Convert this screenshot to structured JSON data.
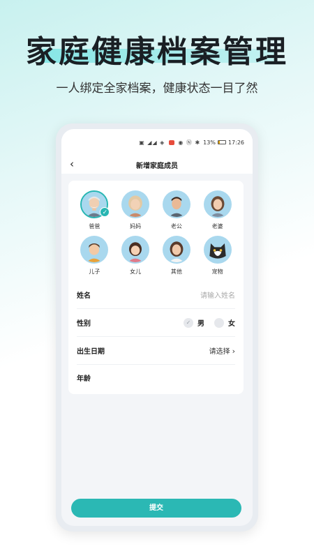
{
  "promo": {
    "title": "家庭健康档案管理",
    "subtitle": "一人绑定全家档案，健康状态一目了然"
  },
  "status_bar": {
    "battery": "13%",
    "time": "17:26"
  },
  "nav": {
    "title": "新增家庭成员"
  },
  "members": [
    {
      "label": "爸爸",
      "selected": true
    },
    {
      "label": "妈妈",
      "selected": false
    },
    {
      "label": "老公",
      "selected": false
    },
    {
      "label": "老婆",
      "selected": false
    },
    {
      "label": "儿子",
      "selected": false
    },
    {
      "label": "女儿",
      "selected": false
    },
    {
      "label": "其他",
      "selected": false
    },
    {
      "label": "宠物",
      "selected": false
    }
  ],
  "form": {
    "name_label": "姓名",
    "name_placeholder": "请输入姓名",
    "gender_label": "性别",
    "gender_male": "男",
    "gender_female": "女",
    "birthdate_label": "出生日期",
    "birthdate_value": "请选择",
    "age_label": "年龄"
  },
  "submit_label": "提交",
  "colors": {
    "accent": "#2bb8b4",
    "avatar_bg": "#a9d8ee"
  }
}
